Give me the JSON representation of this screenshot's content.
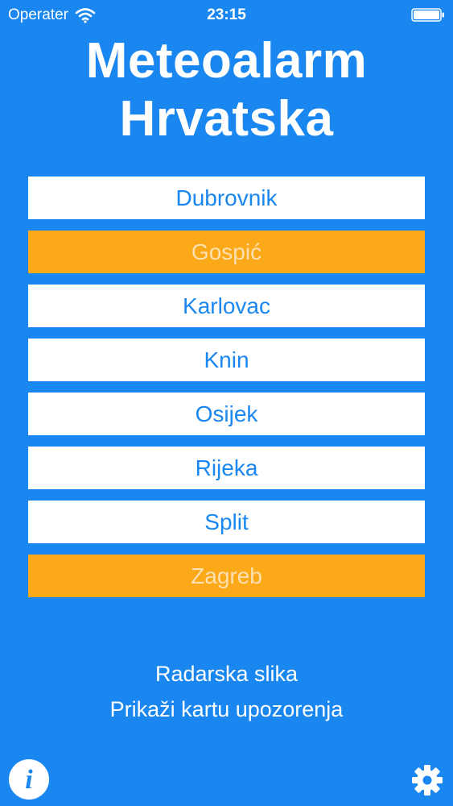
{
  "status_bar": {
    "carrier": "Operater",
    "time": "23:15"
  },
  "header": {
    "title_line1": "Meteoalarm",
    "title_line2": "Hrvatska"
  },
  "cities": [
    {
      "name": "Dubrovnik",
      "warning": false
    },
    {
      "name": "Gospić",
      "warning": true
    },
    {
      "name": "Karlovac",
      "warning": false
    },
    {
      "name": "Knin",
      "warning": false
    },
    {
      "name": "Osijek",
      "warning": false
    },
    {
      "name": "Rijeka",
      "warning": false
    },
    {
      "name": "Split",
      "warning": false
    },
    {
      "name": "Zagreb",
      "warning": true
    }
  ],
  "links": {
    "radar": "Radarska slika",
    "warning_map": "Prikaži kartu upozorenja"
  },
  "footer": {
    "info_icon": "info-icon",
    "info_glyph": "i",
    "settings_icon": "gear-icon"
  },
  "colors": {
    "background": "#1a87f0",
    "warning": "#fba918",
    "button": "#ffffff"
  }
}
